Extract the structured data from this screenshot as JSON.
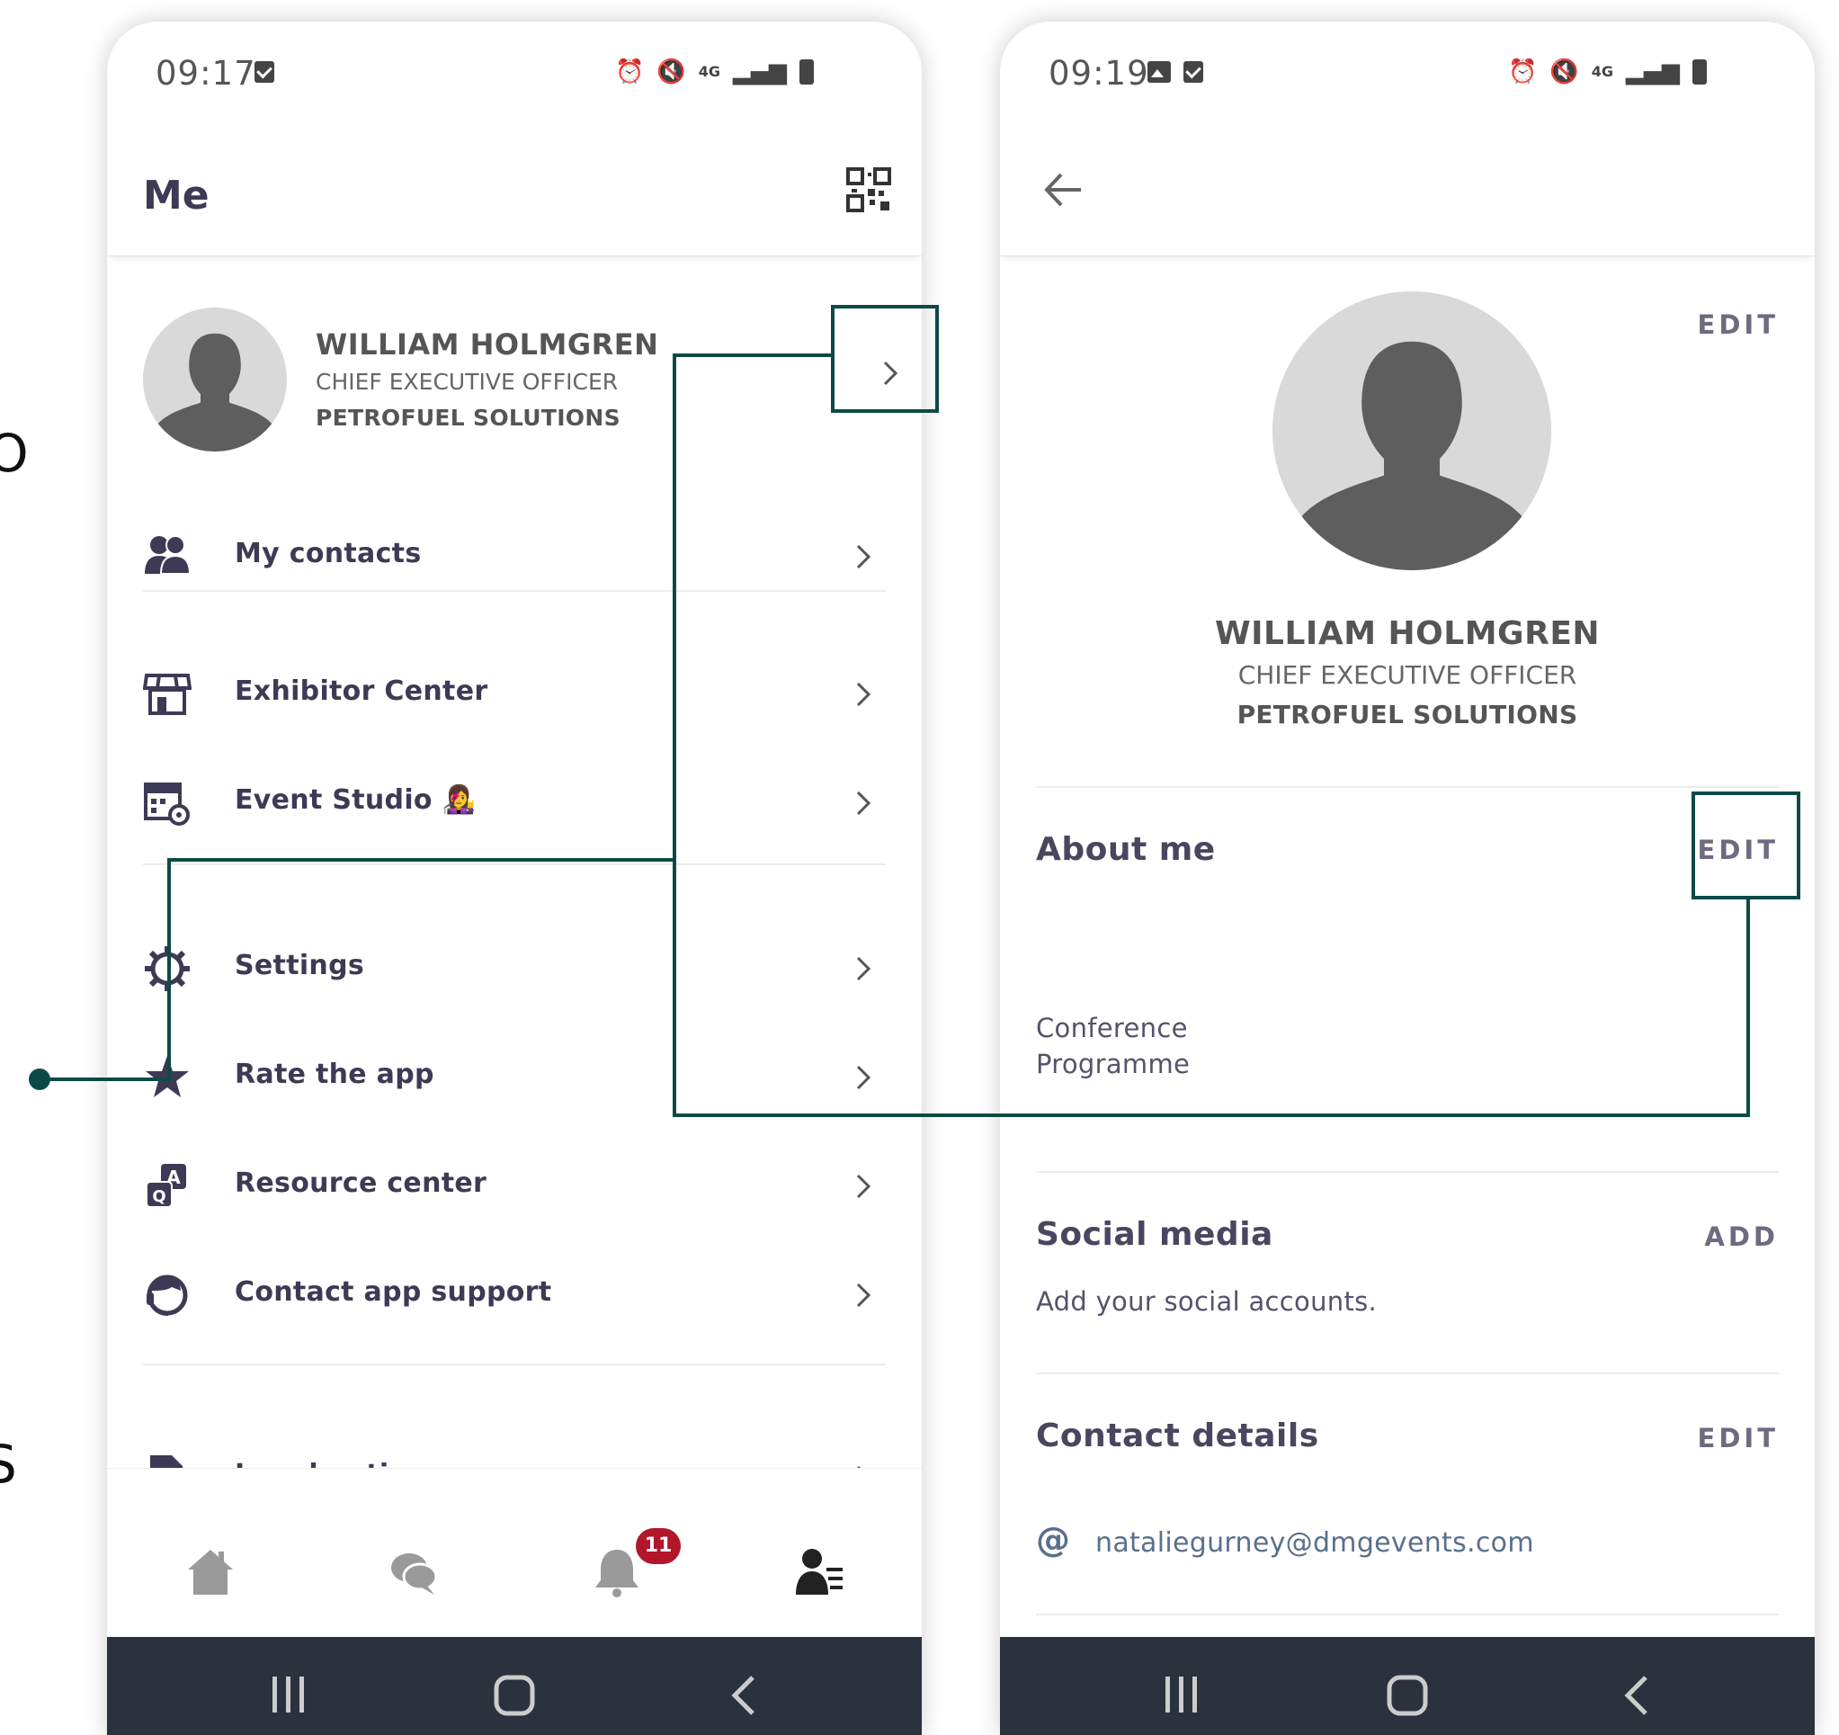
{
  "fragments": {
    "left_mid": "O",
    "left_low": "S"
  },
  "left_screen": {
    "status": {
      "time": "09:17"
    },
    "header": {
      "title": "Me"
    },
    "profile": {
      "name": "WILLIAM HOLMGREN",
      "job_title": "CHIEF EXECUTIVE OFFICER",
      "company": "PETROFUEL SOLUTIONS"
    },
    "menu": [
      {
        "label": "My contacts",
        "icon": "contacts-icon"
      },
      {
        "label": "Exhibitor Center",
        "icon": "store-icon"
      },
      {
        "label": "Event Studio 👩‍🎤",
        "icon": "calendar-settings-icon"
      },
      {
        "label": "Settings",
        "icon": "gear-icon"
      },
      {
        "label": "Rate the app",
        "icon": "star-icon"
      },
      {
        "label": "Resource center",
        "icon": "qa-icon"
      },
      {
        "label": "Contact app support",
        "icon": "headset-icon"
      },
      {
        "label": "Legal notice",
        "icon": "document-edit-icon"
      }
    ],
    "bottom_nav": {
      "items": [
        "home-icon",
        "chat-icon",
        "bell-icon",
        "profile-menu-icon"
      ],
      "notifications_badge": "11"
    }
  },
  "right_screen": {
    "status": {
      "time": "09:19"
    },
    "profile": {
      "edit_label": "EDIT",
      "name": "WILLIAM HOLMGREN",
      "job_title": "CHIEF EXECUTIVE OFFICER",
      "company": "PETROFUEL SOLUTIONS"
    },
    "about": {
      "title": "About me",
      "edit_label": "EDIT",
      "text_line1": "Conference",
      "text_line2": "Programme"
    },
    "social": {
      "title": "Social media",
      "add_label": "ADD",
      "hint": "Add your social accounts."
    },
    "contact": {
      "title": "Contact details",
      "edit_label": "EDIT",
      "email": "nataliegurney@dmgevents.com"
    }
  },
  "colors": {
    "accent_line": "#0d4a47",
    "badge": "#b2162a",
    "text_dark": "#3d3a55",
    "system_bar": "#2b313d"
  }
}
